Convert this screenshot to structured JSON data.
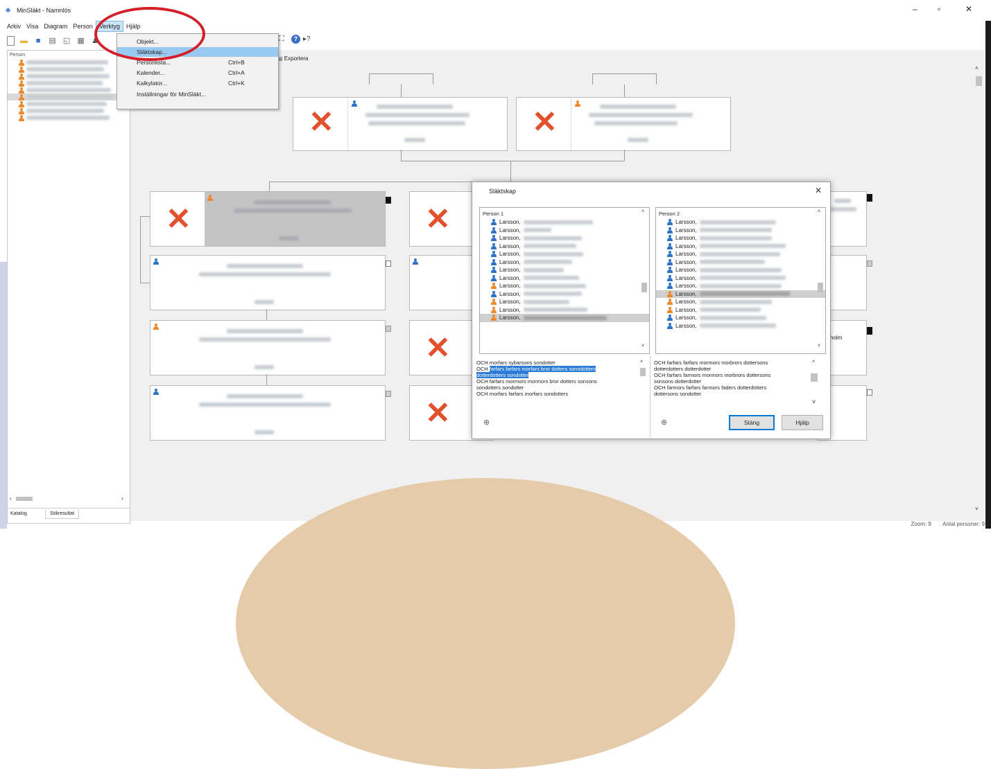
{
  "window": {
    "title": "MinSläkt - Namnlös",
    "minimize": "–",
    "maximize": "▫",
    "close": "✕"
  },
  "menubar": [
    "Arkiv",
    "Visa",
    "Diagram",
    "Person",
    "Verktyg",
    "Hjälp"
  ],
  "toolbar": {
    "help_glyph": "?",
    "whatsthis_glyph": "▸?",
    "export_label": "Exportera"
  },
  "dropdown": {
    "items": [
      {
        "label": "Objekt...",
        "shortcut": ""
      },
      {
        "label": "Släktskap...",
        "shortcut": ""
      },
      {
        "label": "Personlista...",
        "shortcut": "Ctrl+B"
      },
      {
        "label": "Kalender...",
        "shortcut": "Ctrl+A"
      },
      {
        "label": "Kalkylator...",
        "shortcut": "Ctrl+K"
      },
      {
        "label": "Inställningar för MinSläkt...",
        "shortcut": ""
      }
    ]
  },
  "left_panel": {
    "header": "Person",
    "tabs": [
      "Katalog",
      "Sökresultat"
    ]
  },
  "dialog": {
    "title": "Släktskap",
    "person1_header": "Person 1",
    "person2_header": "Person 2",
    "surname": "Larsson,",
    "relations_left": [
      "OCH morfars sybarsons sondotter",
      "OCH farfars farfars morfars bror dotters sonsdotters",
      "dotterdotters sondotter",
      "OCH farfars mormors mormors bror dotters sonsons",
      "sondotters sondotter",
      "OCH morfars farfars morfars sondotters"
    ],
    "relations_right": [
      "OCH farfars farfars mormors morbrors dottersons",
      "dotterdotters dotterdotter",
      "OCH farfars farmors mormors morbrors dottersons",
      "sonsons dotterdotter",
      "OCH farmors farfars farmors faders dotterdotters",
      "dottersons sondotter"
    ],
    "close_button": "Stäng",
    "help_button": "Hjälp",
    "zoom_icon": "⊕"
  },
  "canvas": {
    "partial_label": "ckholm"
  },
  "statusbar": {
    "zoom": "Zoom: 9",
    "count": "Antal personer: 9"
  },
  "colors": {
    "orange": "#ee8a2c",
    "blue": "#2f73c8",
    "cross": "#e2502c",
    "annotation": "#d41f2a",
    "selection": "#2a7bd6"
  }
}
